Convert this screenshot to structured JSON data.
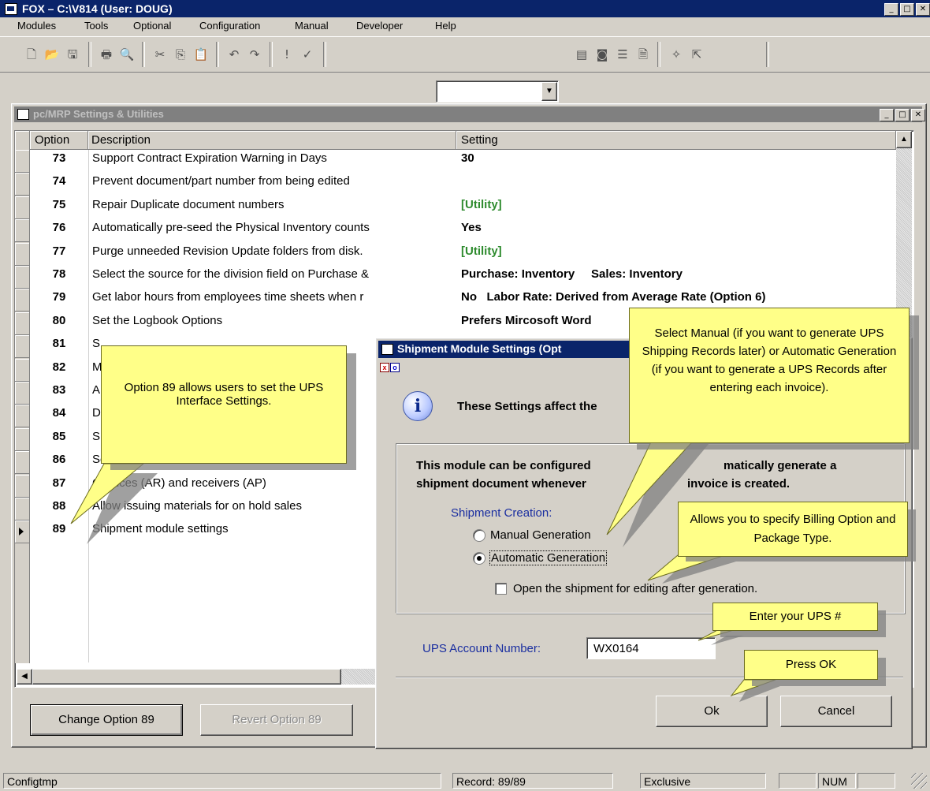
{
  "app": {
    "title": "FOX – C:\\V814  (User: DOUG)"
  },
  "menu": [
    "Modules",
    "Tools",
    "Optional",
    "Configuration",
    "Manual",
    "Developer",
    "Help"
  ],
  "child_window": {
    "title": "pc/MRP Settings & Utilities",
    "columns": [
      "Option",
      "Description",
      "Setting"
    ],
    "rows": [
      {
        "option": "73",
        "description": "Support Contract Expiration Warning in Days",
        "setting": "30"
      },
      {
        "option": "74",
        "description": "Prevent document/part number from being edited",
        "setting": ""
      },
      {
        "option": "75",
        "description": "Repair Duplicate document numbers",
        "setting": "[Utility]"
      },
      {
        "option": "76",
        "description": "Automatically pre-seed the Physical Inventory counts",
        "setting": "Yes"
      },
      {
        "option": "77",
        "description": "Purge unneeded Revision Update folders from disk.",
        "setting": "[Utility]"
      },
      {
        "option": "78",
        "description": "Select the source for the division field on Purchase &",
        "setting": "Purchase: Inventory     Sales: Inventory"
      },
      {
        "option": "79",
        "description": "Get labor hours from employees time sheets when r",
        "setting": "No   Labor Rate: Derived from Average Rate (Option 6)"
      },
      {
        "option": "80",
        "description": "Set the Logbook Options",
        "setting": "Prefers Mircosoft Word"
      },
      {
        "option": "81",
        "description": "S",
        "setting": ""
      },
      {
        "option": "82",
        "description": "M",
        "setting": ""
      },
      {
        "option": "83",
        "description": "A",
        "setting": ""
      },
      {
        "option": "84",
        "description": "D",
        "setting": ""
      },
      {
        "option": "85",
        "description": "S",
        "setting": ""
      },
      {
        "option": "86",
        "description": "Se",
        "setting": ""
      },
      {
        "option": "87",
        "description": "C          voices (AR) and receivers (AP)",
        "setting": ""
      },
      {
        "option": "88",
        "description": "Allow issuing materials for on hold sales",
        "setting": ""
      },
      {
        "option": "89",
        "description": "Shipment module settings",
        "setting": ""
      }
    ],
    "buttons": {
      "change": "Change Option 89",
      "revert": "Revert Option 89"
    }
  },
  "dialog": {
    "title": "Shipment Module Settings  (Opt",
    "mini_icons": [
      "x",
      "o"
    ],
    "info_text": "These Settings affect the",
    "description": "This module can be configured to automatically generate a shipment document whenever an invoice is created.",
    "description_line1": "This module can be configured",
    "description_line1b": "matically generate a",
    "description_line2": "shipment document whenever",
    "description_line2b": "invoice is created.",
    "shipment_creation_label": "Shipment Creation:",
    "radio_manual": "Manual Generation",
    "radio_automatic": "Automatic Generation",
    "selected": "automatic",
    "checkbox_open": "Open the shipment for editing after generation.",
    "checkbox_checked": false,
    "ups_label": "UPS Account Number:",
    "ups_value": "WX0164",
    "ok": "Ok",
    "cancel": "Cancel"
  },
  "callouts": {
    "option89": "Option 89 allows users to set the UPS Interface Settings.",
    "manual_auto": "Select Manual (if you want to generate UPS Shipping Records later) or Automatic Generation (if you want to generate a UPS Records after entering each invoice).",
    "billing": "Allows you to specify Billing Option and Package Type.",
    "ups": "Enter your UPS #",
    "ok": "Press OK"
  },
  "statusbar": {
    "left": "Configtmp",
    "record": "Record: 89/89",
    "mode": "Exclusive",
    "num": "NUM"
  },
  "colors": {
    "titlebar": "#0a246a",
    "callout": "#ffff88",
    "utility_green": "#2e8b2e",
    "label_blue": "#1a2ea0"
  }
}
